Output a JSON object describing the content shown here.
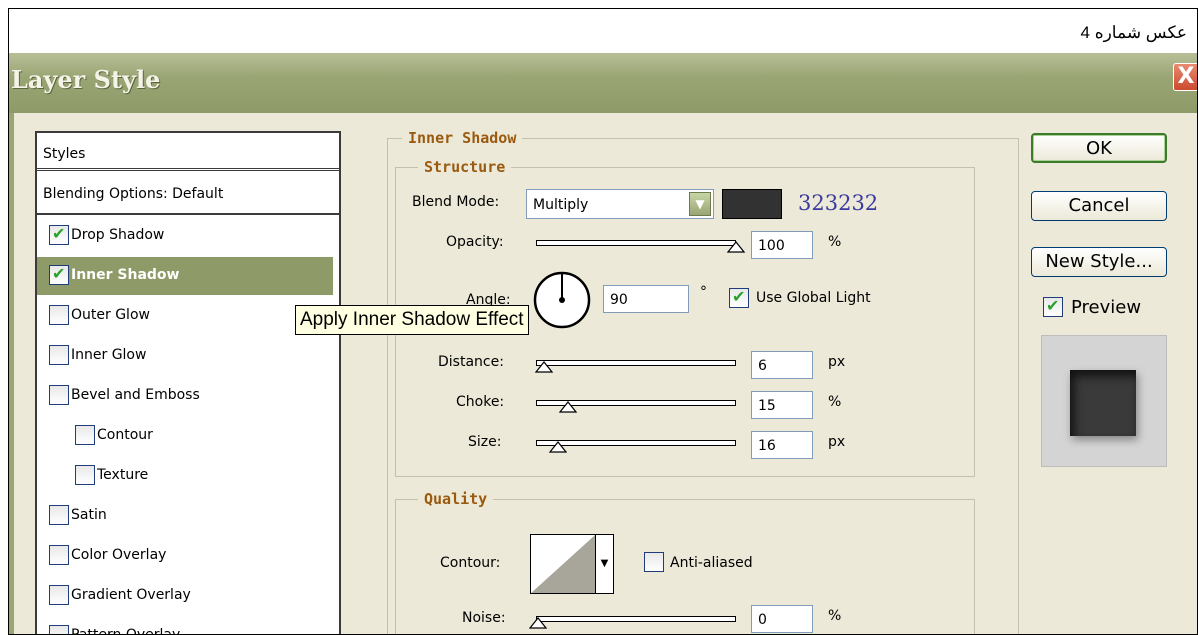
{
  "caption": "عکس شماره 4",
  "dialog": {
    "title": "Layer Style",
    "close_label": "X"
  },
  "styles_panel": {
    "header": "Styles",
    "blending_options": "Blending Options: Default",
    "items": [
      {
        "label": "Drop Shadow",
        "checked": true,
        "selected": false,
        "indent": false
      },
      {
        "label": "Inner Shadow",
        "checked": true,
        "selected": true,
        "indent": false
      },
      {
        "label": "Outer Glow",
        "checked": false,
        "selected": false,
        "indent": false
      },
      {
        "label": "Inner Glow",
        "checked": false,
        "selected": false,
        "indent": false
      },
      {
        "label": "Bevel and Emboss",
        "checked": false,
        "selected": false,
        "indent": false
      },
      {
        "label": "Contour",
        "checked": false,
        "selected": false,
        "indent": true
      },
      {
        "label": "Texture",
        "checked": false,
        "selected": false,
        "indent": true
      },
      {
        "label": "Satin",
        "checked": false,
        "selected": false,
        "indent": false
      },
      {
        "label": "Color Overlay",
        "checked": false,
        "selected": false,
        "indent": false
      },
      {
        "label": "Gradient Overlay",
        "checked": false,
        "selected": false,
        "indent": false
      },
      {
        "label": "Pattern Overlay",
        "checked": false,
        "selected": false,
        "indent": false
      }
    ]
  },
  "inner_shadow": {
    "section_title": "Inner Shadow",
    "structure": {
      "title": "Structure",
      "blend_mode_label": "Blend Mode:",
      "blend_mode_value": "Multiply",
      "color_hex": "#323232",
      "color_annotation": "323232",
      "opacity_label": "Opacity:",
      "opacity_value": "100",
      "opacity_unit": "%",
      "opacity_fraction": 1.0,
      "angle_label": "Angle:",
      "angle_value": "90",
      "angle_unit": "°",
      "use_global_light_label": "Use Global Light",
      "use_global_light_checked": true,
      "distance_label": "Distance:",
      "distance_value": "6",
      "distance_unit": "px",
      "distance_fraction": 0.03,
      "choke_label": "Choke:",
      "choke_value": "15",
      "choke_unit": "%",
      "choke_fraction": 0.15,
      "size_label": "Size:",
      "size_value": "16",
      "size_unit": "px",
      "size_fraction": 0.1
    },
    "quality": {
      "title": "Quality",
      "contour_label": "Contour:",
      "anti_aliased_label": "Anti-aliased",
      "anti_aliased_checked": false,
      "noise_label": "Noise:",
      "noise_value": "0",
      "noise_unit": "%",
      "noise_fraction": 0.0
    }
  },
  "buttons": {
    "ok": "OK",
    "cancel": "Cancel",
    "new_style": "New Style...",
    "preview_label": "Preview",
    "preview_checked": true
  },
  "tooltip": "Apply Inner Shadow Effect",
  "colors": {
    "title_bar": "#9aa574",
    "selected_item": "#8e9a68",
    "legend_text": "#9a5a10",
    "annotation_text": "#3a3aa0"
  }
}
